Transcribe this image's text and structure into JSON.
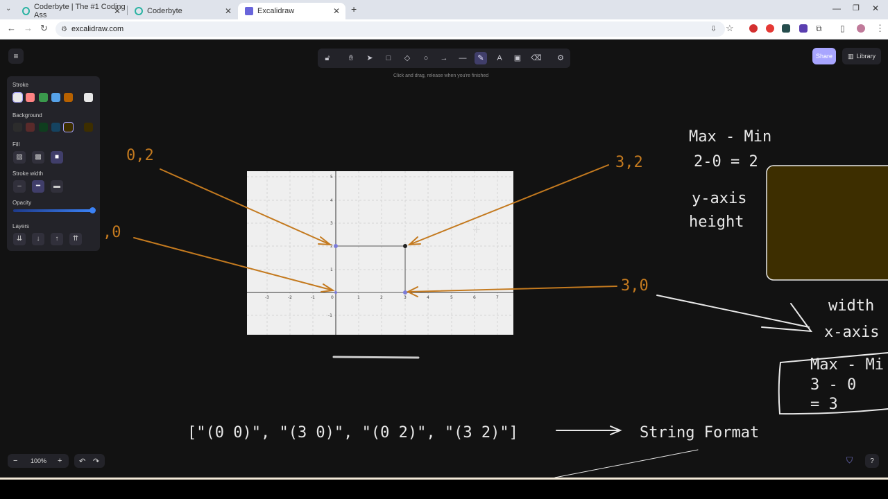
{
  "browser": {
    "tabs": [
      {
        "title": "Coderbyte | The #1 Coding Ass"
      },
      {
        "title": "Coderbyte"
      },
      {
        "title": "Excalidraw"
      }
    ],
    "url": "excalidraw.com"
  },
  "app": {
    "hint": "Click and drag, release when you're finished",
    "share_label": "Share",
    "library_label": "Library",
    "zoom": "100%",
    "panel": {
      "stroke": "Stroke",
      "background": "Background",
      "fill": "Fill",
      "stroke_width": "Stroke width",
      "opacity": "Opacity",
      "layers": "Layers"
    }
  },
  "canvas_text": {
    "label_02": "0,2",
    "label_32": "3,2",
    "label_0": ",0",
    "label_30": "3,0",
    "maxmin1": "Max - Min",
    "calc1": "2-0 = 2",
    "yaxis": "y-axis",
    "height": "height",
    "width": "width",
    "xaxis": "x-axis",
    "maxmin2": "Max - Mi",
    "calc2a": "3 - 0",
    "calc2b": "= 3",
    "array": "[\"(0 0)\", \"(3 0)\", \"(0 2)\", \"(3 2)\"]",
    "string_format": "String Format"
  },
  "graph": {
    "x_ticks": [
      "-3",
      "-2",
      "-1",
      "0",
      "1",
      "2",
      "3",
      "4",
      "5",
      "6",
      "7"
    ],
    "y_ticks": [
      "5",
      "4",
      "3",
      "2",
      "1",
      "-1"
    ]
  },
  "colors": {
    "accent": "#c47a1f",
    "brand": "#a8a5ff"
  }
}
